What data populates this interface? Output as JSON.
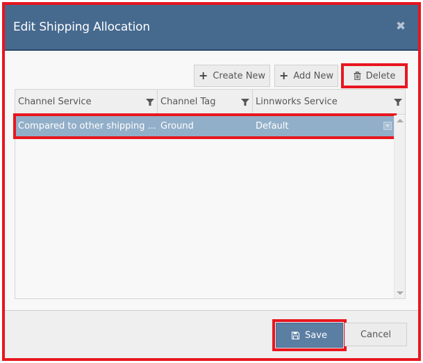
{
  "dialog": {
    "title": "Edit Shipping Allocation",
    "close_icon": "close-icon"
  },
  "toolbar": {
    "create_new_label": "Create New",
    "add_new_label": "Add New",
    "delete_label": "Delete"
  },
  "grid": {
    "columns": [
      {
        "label": "Channel Service"
      },
      {
        "label": "Channel Tag"
      },
      {
        "label": "Linnworks Service"
      }
    ],
    "rows": [
      {
        "channel_service": "Compared to other shipping ...",
        "channel_tag": "Ground",
        "linnworks_service": "Default",
        "selected": true
      }
    ]
  },
  "footer": {
    "save_label": "Save",
    "cancel_label": "Cancel"
  },
  "colors": {
    "header_bg": "#46698e",
    "selected_row": "#92afc9",
    "save_button": "#5b7ea3",
    "highlight": "#e8161f"
  }
}
